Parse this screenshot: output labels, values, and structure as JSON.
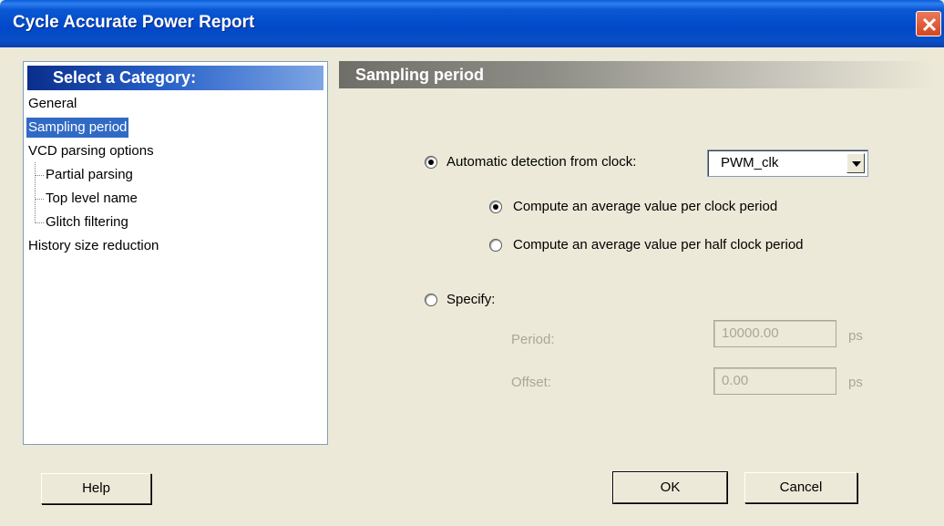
{
  "window": {
    "title": "Cycle Accurate Power Report",
    "close_icon": "close-icon"
  },
  "categories": {
    "header": "Select a Category:",
    "items": [
      {
        "label": "General",
        "selected": false,
        "level": 0
      },
      {
        "label": "Sampling period",
        "selected": true,
        "level": 0
      },
      {
        "label": "VCD parsing options",
        "selected": false,
        "level": 0
      },
      {
        "label": "Partial parsing",
        "selected": false,
        "level": 1
      },
      {
        "label": "Top level name",
        "selected": false,
        "level": 1
      },
      {
        "label": "Glitch filtering",
        "selected": false,
        "level": 1
      },
      {
        "label": "History size reduction",
        "selected": false,
        "level": 0
      }
    ]
  },
  "section": {
    "title": "Sampling period",
    "auto_detect": {
      "label": "Automatic detection from clock:",
      "checked": true,
      "clock_value": "PWM_clk"
    },
    "average_full": {
      "label": "Compute an average value per clock period",
      "checked": true
    },
    "average_half": {
      "label": "Compute an average value per half clock period",
      "checked": false
    },
    "specify": {
      "label": "Specify:",
      "checked": false
    },
    "period": {
      "label": "Period:",
      "value": "10000.00",
      "unit": "ps"
    },
    "offset": {
      "label": "Offset:",
      "value": "0.00",
      "unit": "ps"
    }
  },
  "buttons": {
    "help": "Help",
    "ok": "OK",
    "cancel": "Cancel"
  },
  "colors": {
    "titlebar": "#0a4fc6",
    "selection": "#316ac5",
    "dialog_bg": "#ece9d8",
    "disabled_text": "#a9a798"
  }
}
